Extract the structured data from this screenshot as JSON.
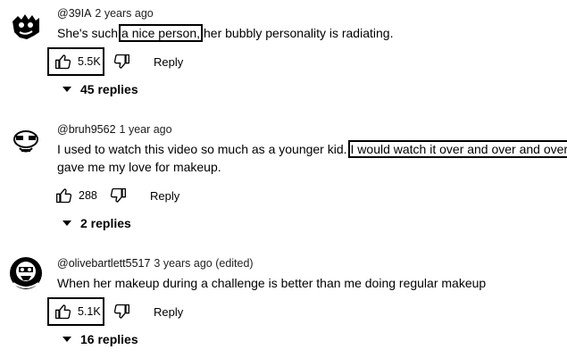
{
  "comments": [
    {
      "author": "@39IA",
      "time": "2 years ago",
      "text_before": "She's such",
      "text_highlight": "a nice person,",
      "text_after": "her bubbly personality is radiating.",
      "likes": "5.5K",
      "reply_label": "Reply",
      "replies_label": "45 replies"
    },
    {
      "author": "@bruh9562",
      "time": "1 year ago",
      "text_line1_before": "I used to watch this video so much as a younger kid.",
      "text_line1_highlight": "I would watch it over and over and over.",
      "text_line2": "gave me my love for makeup.",
      "likes": "288",
      "reply_label": "Reply",
      "replies_label": "2 replies"
    },
    {
      "author": "@olivebartlett5517",
      "time": "3 years ago (edited)",
      "text": "When her makeup during a challenge is better than me doing regular makeup",
      "likes": "5.1K",
      "reply_label": "Reply",
      "replies_label": "16 replies"
    }
  ],
  "icons": {
    "like": "thumbs-up-icon",
    "dislike": "thumbs-down-icon",
    "expand": "caret-down-icon"
  }
}
